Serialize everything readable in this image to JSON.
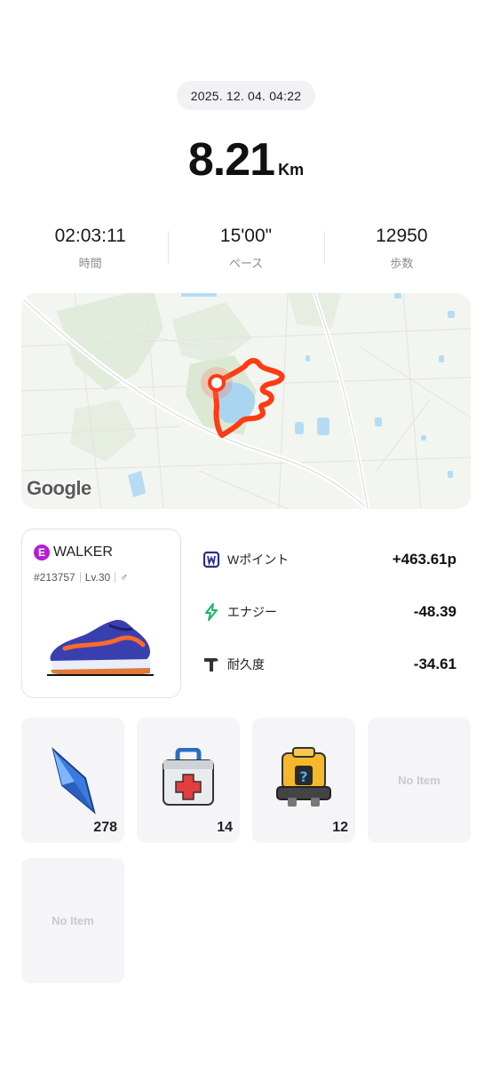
{
  "activity": {
    "datetime": "2025. 12. 04. 04:22",
    "distance_value": "8.21",
    "distance_unit": "Km"
  },
  "stats": [
    {
      "value": "02:03:11",
      "label": "時間"
    },
    {
      "value": "15'00\"",
      "label": "ペース"
    },
    {
      "value": "12950",
      "label": "歩数"
    }
  ],
  "map": {
    "attribution": "Google",
    "route_color": "#ff3b14"
  },
  "walker": {
    "badge": "E",
    "name": "WALKER",
    "id": "#213757",
    "level": "Lv.30",
    "gender_symbol": "♂"
  },
  "metrics": [
    {
      "icon": "w-point-icon",
      "label": "Wポイント",
      "value": "+463.61p"
    },
    {
      "icon": "energy-bolt-icon",
      "label": "エナジー",
      "value": "-48.39"
    },
    {
      "icon": "durability-hammer-icon",
      "label": "耐久度",
      "value": "-34.61"
    }
  ],
  "items": [
    {
      "icon": "blue-gem-icon",
      "count": "278"
    },
    {
      "icon": "first-aid-kit-icon",
      "count": "14"
    },
    {
      "icon": "mystery-box-icon",
      "count": "12"
    },
    {
      "empty_label": "No Item"
    },
    {
      "empty_label": "No Item"
    }
  ],
  "colors": {
    "accent_route": "#ff3b14",
    "walker_badge": "#b21fd1",
    "energy_green": "#1db36b",
    "w_point_navy": "#2a2f8a"
  }
}
